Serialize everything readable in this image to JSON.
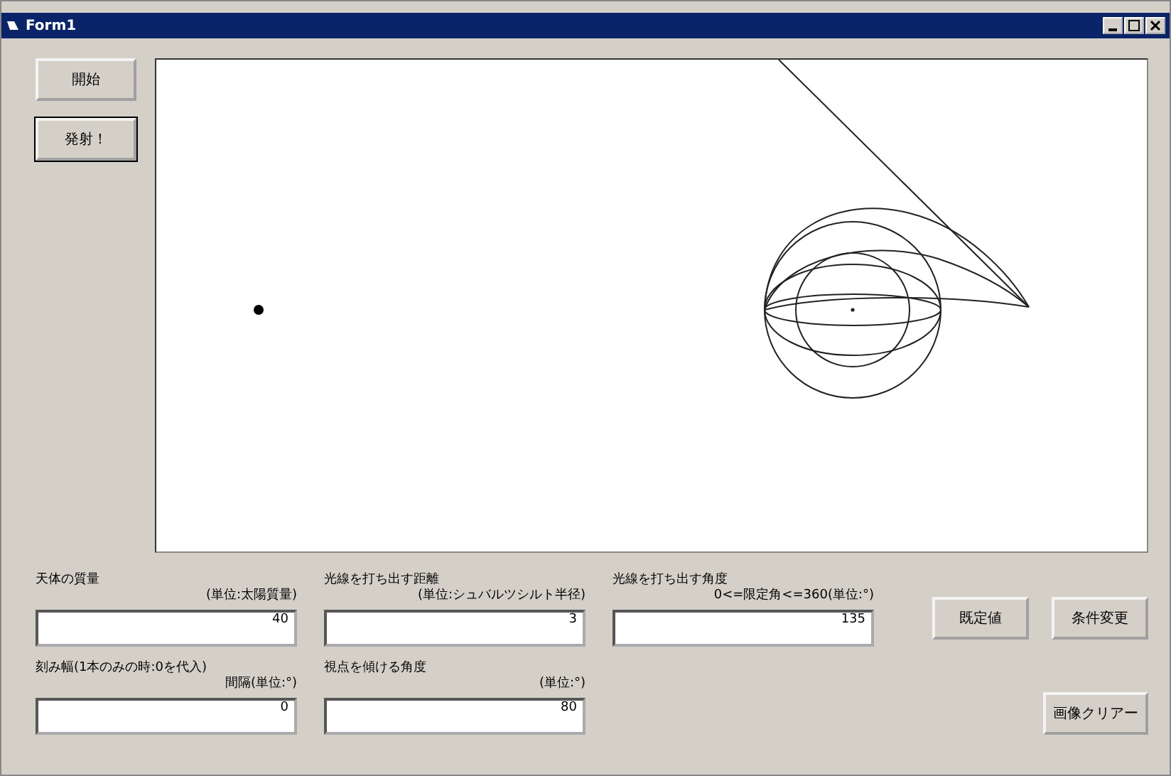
{
  "window": {
    "title": "Form1"
  },
  "left_buttons": [
    "開始",
    "発射！"
  ],
  "fields": [
    {
      "label": "天体の質量",
      "unit": "(単位:太陽質量)",
      "value": "40"
    },
    {
      "label": "光線を打ち出す距離",
      "unit": "(単位:シュバルツシルト半径)",
      "value": "3"
    },
    {
      "label": "光線を打ち出す角度",
      "unit": "0<=限定角<=360(単位:°)",
      "value": "135"
    },
    {
      "label": "刻み幅(1本のみの時:0を代入)",
      "unit": "間隔(単位:°)",
      "value": "0"
    },
    {
      "label": "視点を傾ける角度",
      "unit": "(単位:°)",
      "value": "80"
    }
  ],
  "right_buttons": [
    "既定値",
    "条件変更"
  ],
  "clear_button": "画像クリアー"
}
